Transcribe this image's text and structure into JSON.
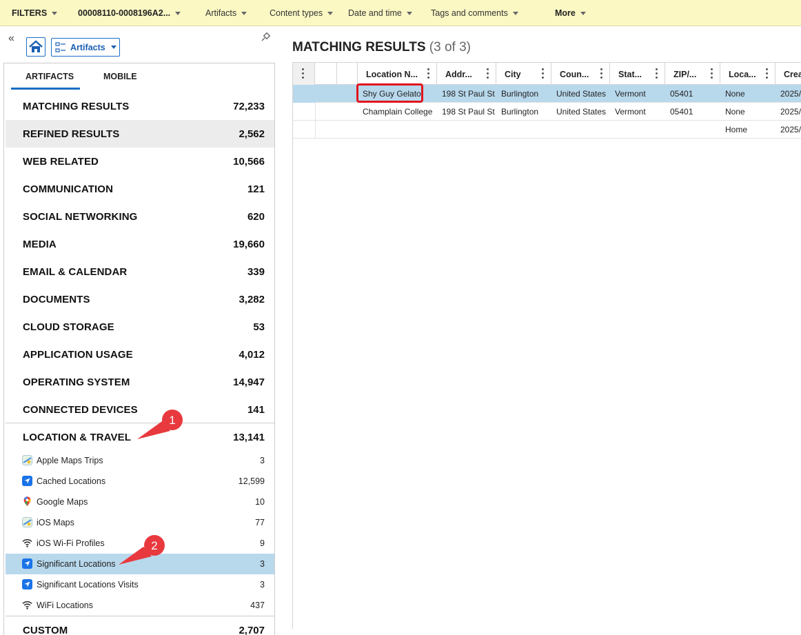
{
  "filterbar": {
    "filters_label": "FILTERS",
    "evidence_label": "00008110-0008196A2...",
    "artifacts_label": "Artifacts",
    "content_types_label": "Content types",
    "date_time_label": "Date and time",
    "tags_label": "Tags and comments",
    "more_label": "More"
  },
  "leftpanel": {
    "view_dropdown_label": "Artifacts",
    "tabs": [
      "ARTIFACTS",
      "MOBILE"
    ],
    "categories": [
      {
        "name": "MATCHING RESULTS",
        "count": "72,233"
      },
      {
        "name": "REFINED RESULTS",
        "count": "2,562"
      },
      {
        "name": "WEB RELATED",
        "count": "10,566"
      },
      {
        "name": "COMMUNICATION",
        "count": "121"
      },
      {
        "name": "SOCIAL NETWORKING",
        "count": "620"
      },
      {
        "name": "MEDIA",
        "count": "19,660"
      },
      {
        "name": "EMAIL & CALENDAR",
        "count": "339"
      },
      {
        "name": "DOCUMENTS",
        "count": "3,282"
      },
      {
        "name": "CLOUD STORAGE",
        "count": "53"
      },
      {
        "name": "APPLICATION USAGE",
        "count": "4,012"
      },
      {
        "name": "OPERATING SYSTEM",
        "count": "14,947"
      },
      {
        "name": "CONNECTED DEVICES",
        "count": "141"
      },
      {
        "name": "LOCATION & TRAVEL",
        "count": "13,141"
      }
    ],
    "location_items": [
      {
        "name": "Apple Maps Trips",
        "count": "3",
        "icon": "apple-maps-icon"
      },
      {
        "name": "Cached Locations",
        "count": "12,599",
        "icon": "location-arrow-icon"
      },
      {
        "name": "Google Maps",
        "count": "10",
        "icon": "google-maps-icon"
      },
      {
        "name": "iOS Maps",
        "count": "77",
        "icon": "apple-maps-icon"
      },
      {
        "name": "iOS Wi-Fi Profiles",
        "count": "9",
        "icon": "wifi-icon"
      },
      {
        "name": "Significant Locations",
        "count": "3",
        "icon": "location-arrow-icon"
      },
      {
        "name": "Significant Locations Visits",
        "count": "3",
        "icon": "location-arrow-icon"
      },
      {
        "name": "WiFi Locations",
        "count": "437",
        "icon": "wifi-icon"
      }
    ],
    "partial_category": {
      "name": "CUSTOM",
      "count": "2,707"
    }
  },
  "results": {
    "title": "MATCHING RESULTS",
    "count_text": "(3 of 3)",
    "columns": [
      "Location N...",
      "Addr...",
      "City",
      "Coun...",
      "Stat...",
      "ZIP/...",
      "Loca...",
      "Crea"
    ],
    "rows": [
      [
        "Shy Guy Gelato",
        "198 St Paul St",
        "Burlington",
        "United States",
        "Vermont",
        "05401",
        "None",
        "2025/"
      ],
      [
        "Champlain College",
        "198 St Paul St",
        "Burlington",
        "United States",
        "Vermont",
        "05401",
        "None",
        "2025/"
      ],
      [
        "",
        "",
        "",
        "",
        "",
        "",
        "Home",
        "2025/"
      ]
    ]
  },
  "annotations": [
    "1",
    "2"
  ],
  "colors": {
    "filterbar_bg": "#fbf8c4",
    "accent": "#1a6ec4",
    "selection": "#b8d8ec",
    "marker": "#e8393e"
  }
}
